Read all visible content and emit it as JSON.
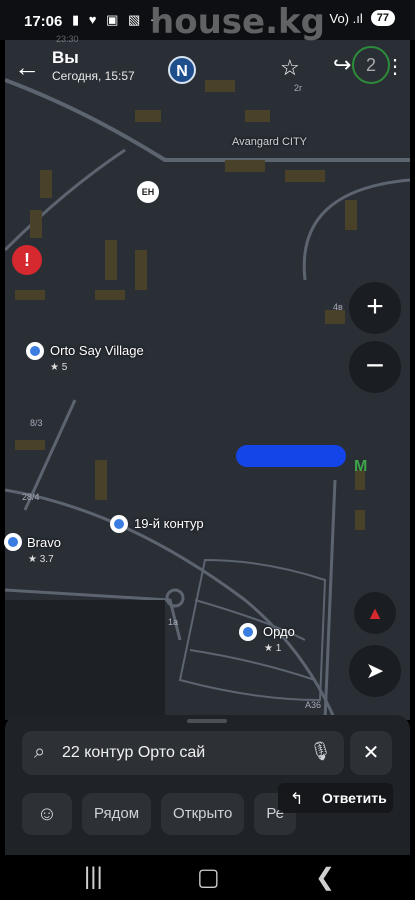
{
  "status": {
    "time": "17:06",
    "icons": "▮ ♥ ▣ ▧ ·",
    "signal": "Vo) .ıl",
    "battery": "77"
  },
  "watermark": "house.kg",
  "watermark_mini": "23:30",
  "header": {
    "title": "Вы",
    "subtitle": "Сегодня, 15:57",
    "badge_count": "2",
    "logo": "N"
  },
  "map": {
    "labels": [
      {
        "text": "Avangard CITY"
      },
      {
        "text": "Orto Say Village"
      },
      {
        "text": "★ 5"
      },
      {
        "text": "19-й контур"
      },
      {
        "text": "Bravo"
      },
      {
        "text": "★ 3.7"
      },
      {
        "text": "Ордо"
      },
      {
        "text": "★ 1"
      }
    ],
    "small": [
      "8/3",
      "28/4",
      "4в",
      "A36",
      "1а",
      "2г"
    ],
    "en_label": "EH",
    "metro_label": "M",
    "alert_label": "!"
  },
  "controls": {
    "zoom_in": "+",
    "zoom_out": "−",
    "compass": "▲",
    "locate": "➤"
  },
  "search": {
    "value": "22 контур Орто сай",
    "clear": "✕"
  },
  "chips": [
    "Рядом",
    "Открыто",
    "Ре"
  ],
  "reply": {
    "label": "Ответить"
  },
  "colors": {
    "map_bg": "#2a2f36",
    "panel": "#1f2226",
    "accent_blue": "#3b7de0",
    "alert_red": "#d6282f",
    "metro_green": "#3da44a"
  }
}
